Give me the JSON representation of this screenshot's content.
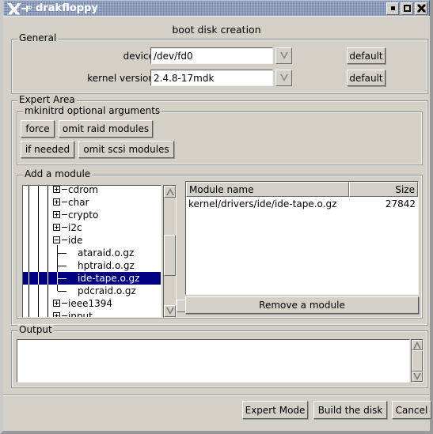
{
  "window": {
    "title": "drakfloppy",
    "logo_icon": "x-window-logo-icon",
    "buttons": {
      "minimize": "minimize-icon",
      "maximize": "maximize-icon",
      "close": "close-icon"
    }
  },
  "header": {
    "title": "boot disk creation"
  },
  "general": {
    "legend": "General",
    "device": {
      "label": "device",
      "value": "/dev/fd0",
      "placeholder": "",
      "default_label": "default"
    },
    "kernel": {
      "label": "kernel version",
      "value": "2.4.8-17mdk",
      "placeholder": "",
      "default_label": "default"
    }
  },
  "expert": {
    "legend": "Expert Area",
    "mkinitrd": {
      "legend": "mkinitrd optional arguments",
      "buttons": [
        {
          "label": "force"
        },
        {
          "label": "omit raid modules"
        },
        {
          "label": "if needed"
        },
        {
          "label": "omit scsi modules"
        }
      ]
    },
    "add_module": {
      "legend": "Add a module",
      "tree": [
        {
          "label": "cdrom",
          "depth": 1,
          "expander": "plus",
          "selected": false,
          "clipped": true
        },
        {
          "label": "char",
          "depth": 1,
          "expander": "plus",
          "selected": false
        },
        {
          "label": "crypto",
          "depth": 1,
          "expander": "plus",
          "selected": false
        },
        {
          "label": "i2c",
          "depth": 1,
          "expander": "plus",
          "selected": false
        },
        {
          "label": "ide",
          "depth": 1,
          "expander": "minus",
          "selected": false
        },
        {
          "label": "ataraid.o.gz",
          "depth": 2,
          "expander": "none",
          "selected": false
        },
        {
          "label": "hptraid.o.gz",
          "depth": 2,
          "expander": "none",
          "selected": false
        },
        {
          "label": "ide-tape.o.gz",
          "depth": 2,
          "expander": "none",
          "selected": true
        },
        {
          "label": "pdcraid.o.gz",
          "depth": 2,
          "expander": "none",
          "selected": false,
          "last": true
        },
        {
          "label": "ieee1394",
          "depth": 1,
          "expander": "plus",
          "selected": false
        },
        {
          "label": "input",
          "depth": 1,
          "expander": "plus",
          "selected": false
        }
      ],
      "scrollbar": {
        "up_icon": "scroll-up-arrow-icon",
        "down_icon": "scroll-down-arrow-icon"
      }
    },
    "module_list": {
      "columns": [
        {
          "label": "Module name",
          "align": "left"
        },
        {
          "label": "Size",
          "align": "right"
        }
      ],
      "rows": [
        {
          "name": "kernel/drivers/ide/ide-tape.o.gz",
          "size": "27842"
        }
      ],
      "remove_label": "Remove a module"
    }
  },
  "output": {
    "legend": "Output",
    "text": "",
    "scrollbar": {
      "up_icon": "scroll-up-arrow-icon",
      "down_icon": "scroll-down-arrow-icon"
    }
  },
  "footer": {
    "buttons": [
      {
        "label": "Expert Mode"
      },
      {
        "label": "Build the disk"
      },
      {
        "label": "Cancel"
      }
    ]
  },
  "colors": {
    "titlebar": "#6d81a8",
    "face": "#d4d0c8",
    "selection": "#000080",
    "field_bg": "#ffffff"
  }
}
